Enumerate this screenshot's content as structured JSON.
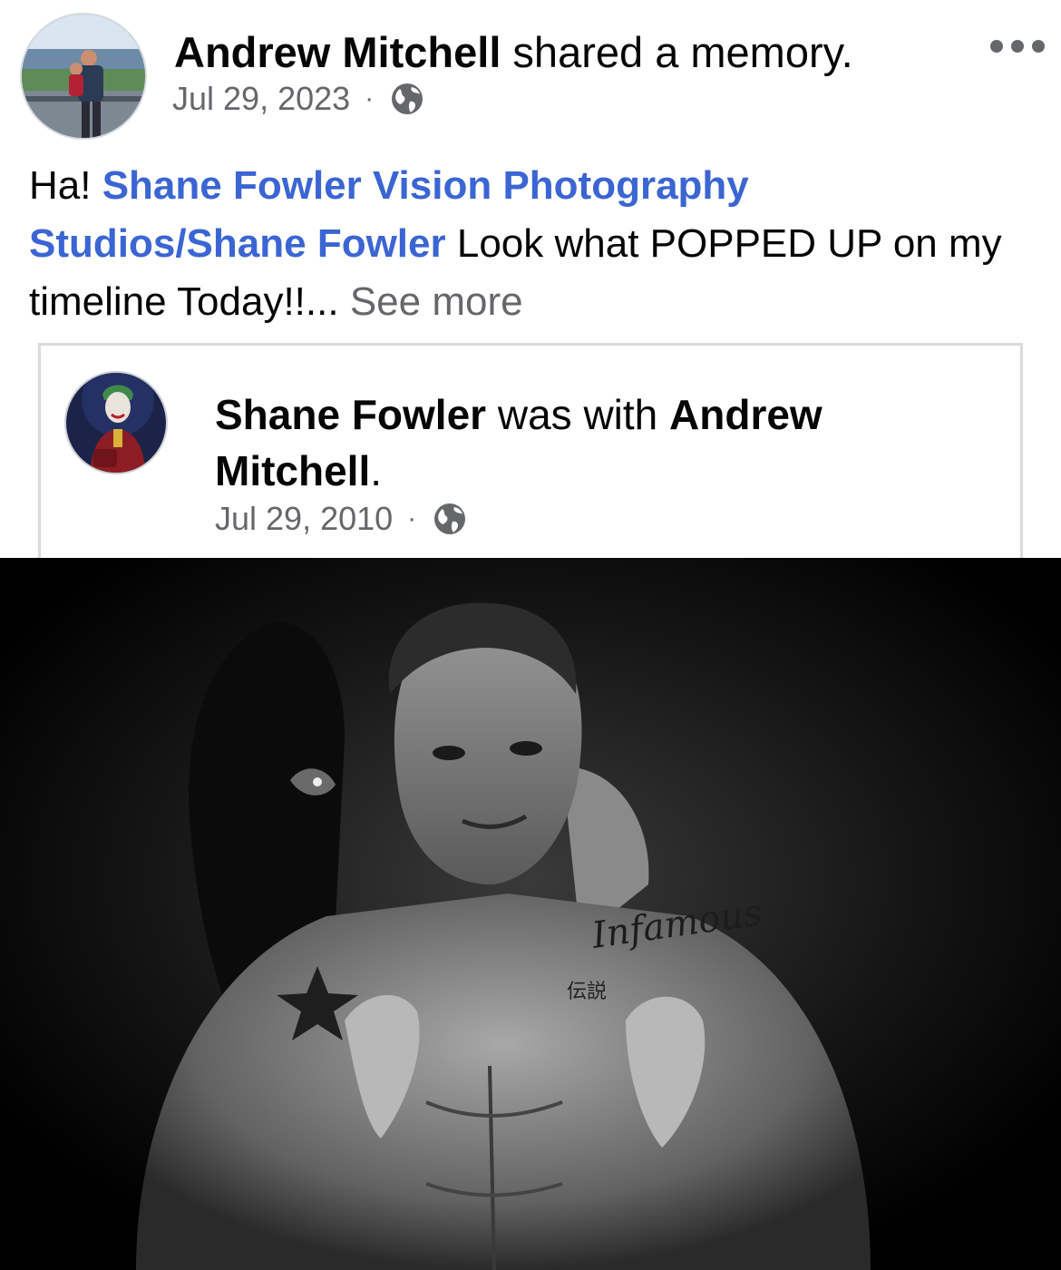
{
  "post": {
    "author_name": "Andrew Mitchell",
    "action_text": " shared a memory.",
    "date": "Jul 29, 2023",
    "separator": "·",
    "privacy_icon": "globe-icon",
    "menu_icon": "more-horizontal-icon",
    "text": {
      "prefix": "Ha! ",
      "mention": "Shane Fowler Vision Photography Studios/Shane Fowler",
      "body": " Look what POPPED UP on my timeline Today!!...",
      "see_more": " See more"
    }
  },
  "shared_memory": {
    "author_name": "Shane Fowler",
    "connector": " was with ",
    "tagged_name": "Andrew Mitchell",
    "period": ".",
    "date": "Jul 29, 2010",
    "separator": "·",
    "privacy_icon": "globe-icon"
  },
  "photo": {
    "tattoo_text": "Infamous",
    "tattoo_kanji": "伝説"
  },
  "colors": {
    "link": "#3b65d3",
    "secondary_text": "#65676b",
    "border": "#d8dadf"
  }
}
